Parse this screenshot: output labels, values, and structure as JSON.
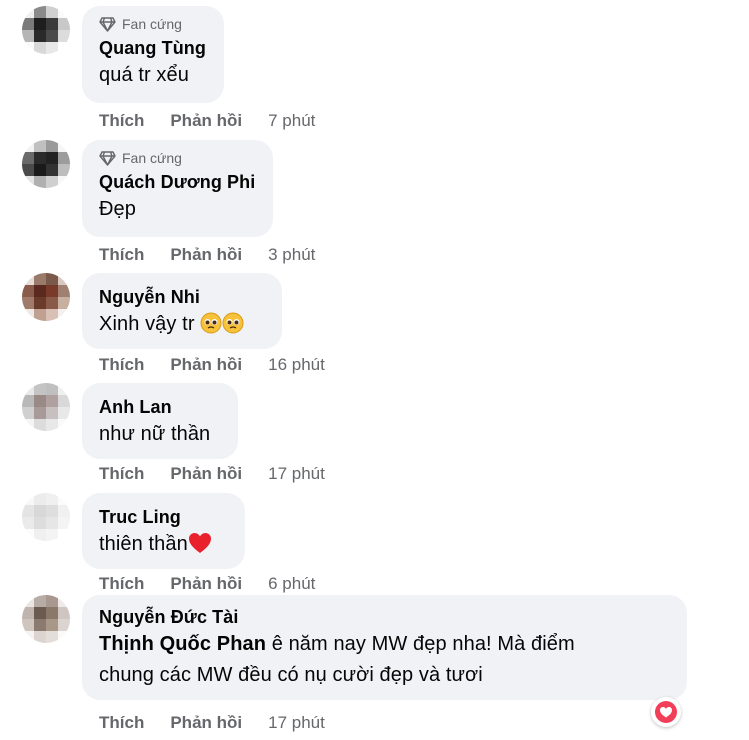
{
  "badge_label": "Fan cứng",
  "like_label": "Thích",
  "reply_label": "Phản hồi",
  "comments": [
    {
      "author": "Quang Tùng",
      "text": "quá tr xểu",
      "time": "7 phút",
      "badge": true
    },
    {
      "author": "Quách Dương Phi",
      "text": "Đẹp",
      "time": "3 phút",
      "badge": true
    },
    {
      "author": "Nguyễn Nhi",
      "text": "Xinh vậy tr",
      "time": "16 phút",
      "emojis": [
        "pleading-face",
        "pleading-face"
      ]
    },
    {
      "author": "Anh Lan",
      "text": "như nữ thần",
      "time": "17 phút"
    },
    {
      "author": "Truc Ling",
      "text": "thiên thần",
      "time": "6 phút",
      "emojis": [
        "red-heart"
      ]
    },
    {
      "author": "Nguyễn Đức Tài",
      "mention": "Thịnh Quốc Phan",
      "text_line1": " ê năm nay MW đẹp nha! Mà điểm",
      "text_line2": "chung các MW đều có nụ cười đẹp và tươi",
      "time": "17 phút",
      "reaction": "love"
    }
  ],
  "colors": {
    "bubble": "#f0f2f5",
    "meta": "#65676b",
    "text": "#050505",
    "love": "#f33e58"
  }
}
